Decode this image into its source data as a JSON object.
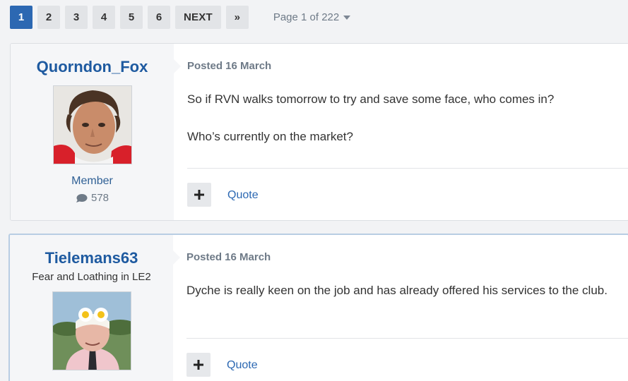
{
  "pagination": {
    "pages": [
      "1",
      "2",
      "3",
      "4",
      "5",
      "6"
    ],
    "active": "1",
    "next_label": "NEXT",
    "last_label": "»",
    "page_info": "Page 1 of 222"
  },
  "posts": [
    {
      "username": "Quorndon_Fox",
      "user_title": "",
      "group": "Member",
      "post_count": "578",
      "posted": "Posted 16 March",
      "paragraphs": [
        "So if RVN walks tomorrow to try and save some face, who comes in?",
        "Who’s currently on the market?"
      ],
      "quote_label": "Quote"
    },
    {
      "username": "Tielemans63",
      "user_title": "Fear and Loathing in LE2",
      "posted": "Posted 16 March",
      "paragraphs": [
        "Dyche is really keen on the job and has already offered his services to the club."
      ],
      "quote_label": "Quote"
    }
  ],
  "colors": {
    "accent": "#2c68b2",
    "username": "#1e5aa0",
    "muted": "#6e7a87",
    "background": "#f2f3f5"
  },
  "icons": {
    "post_count": "speech-bubble-icon",
    "add": "plus-icon",
    "page_jump": "caret-down-icon",
    "last_page": "double-chevron-right-icon"
  }
}
